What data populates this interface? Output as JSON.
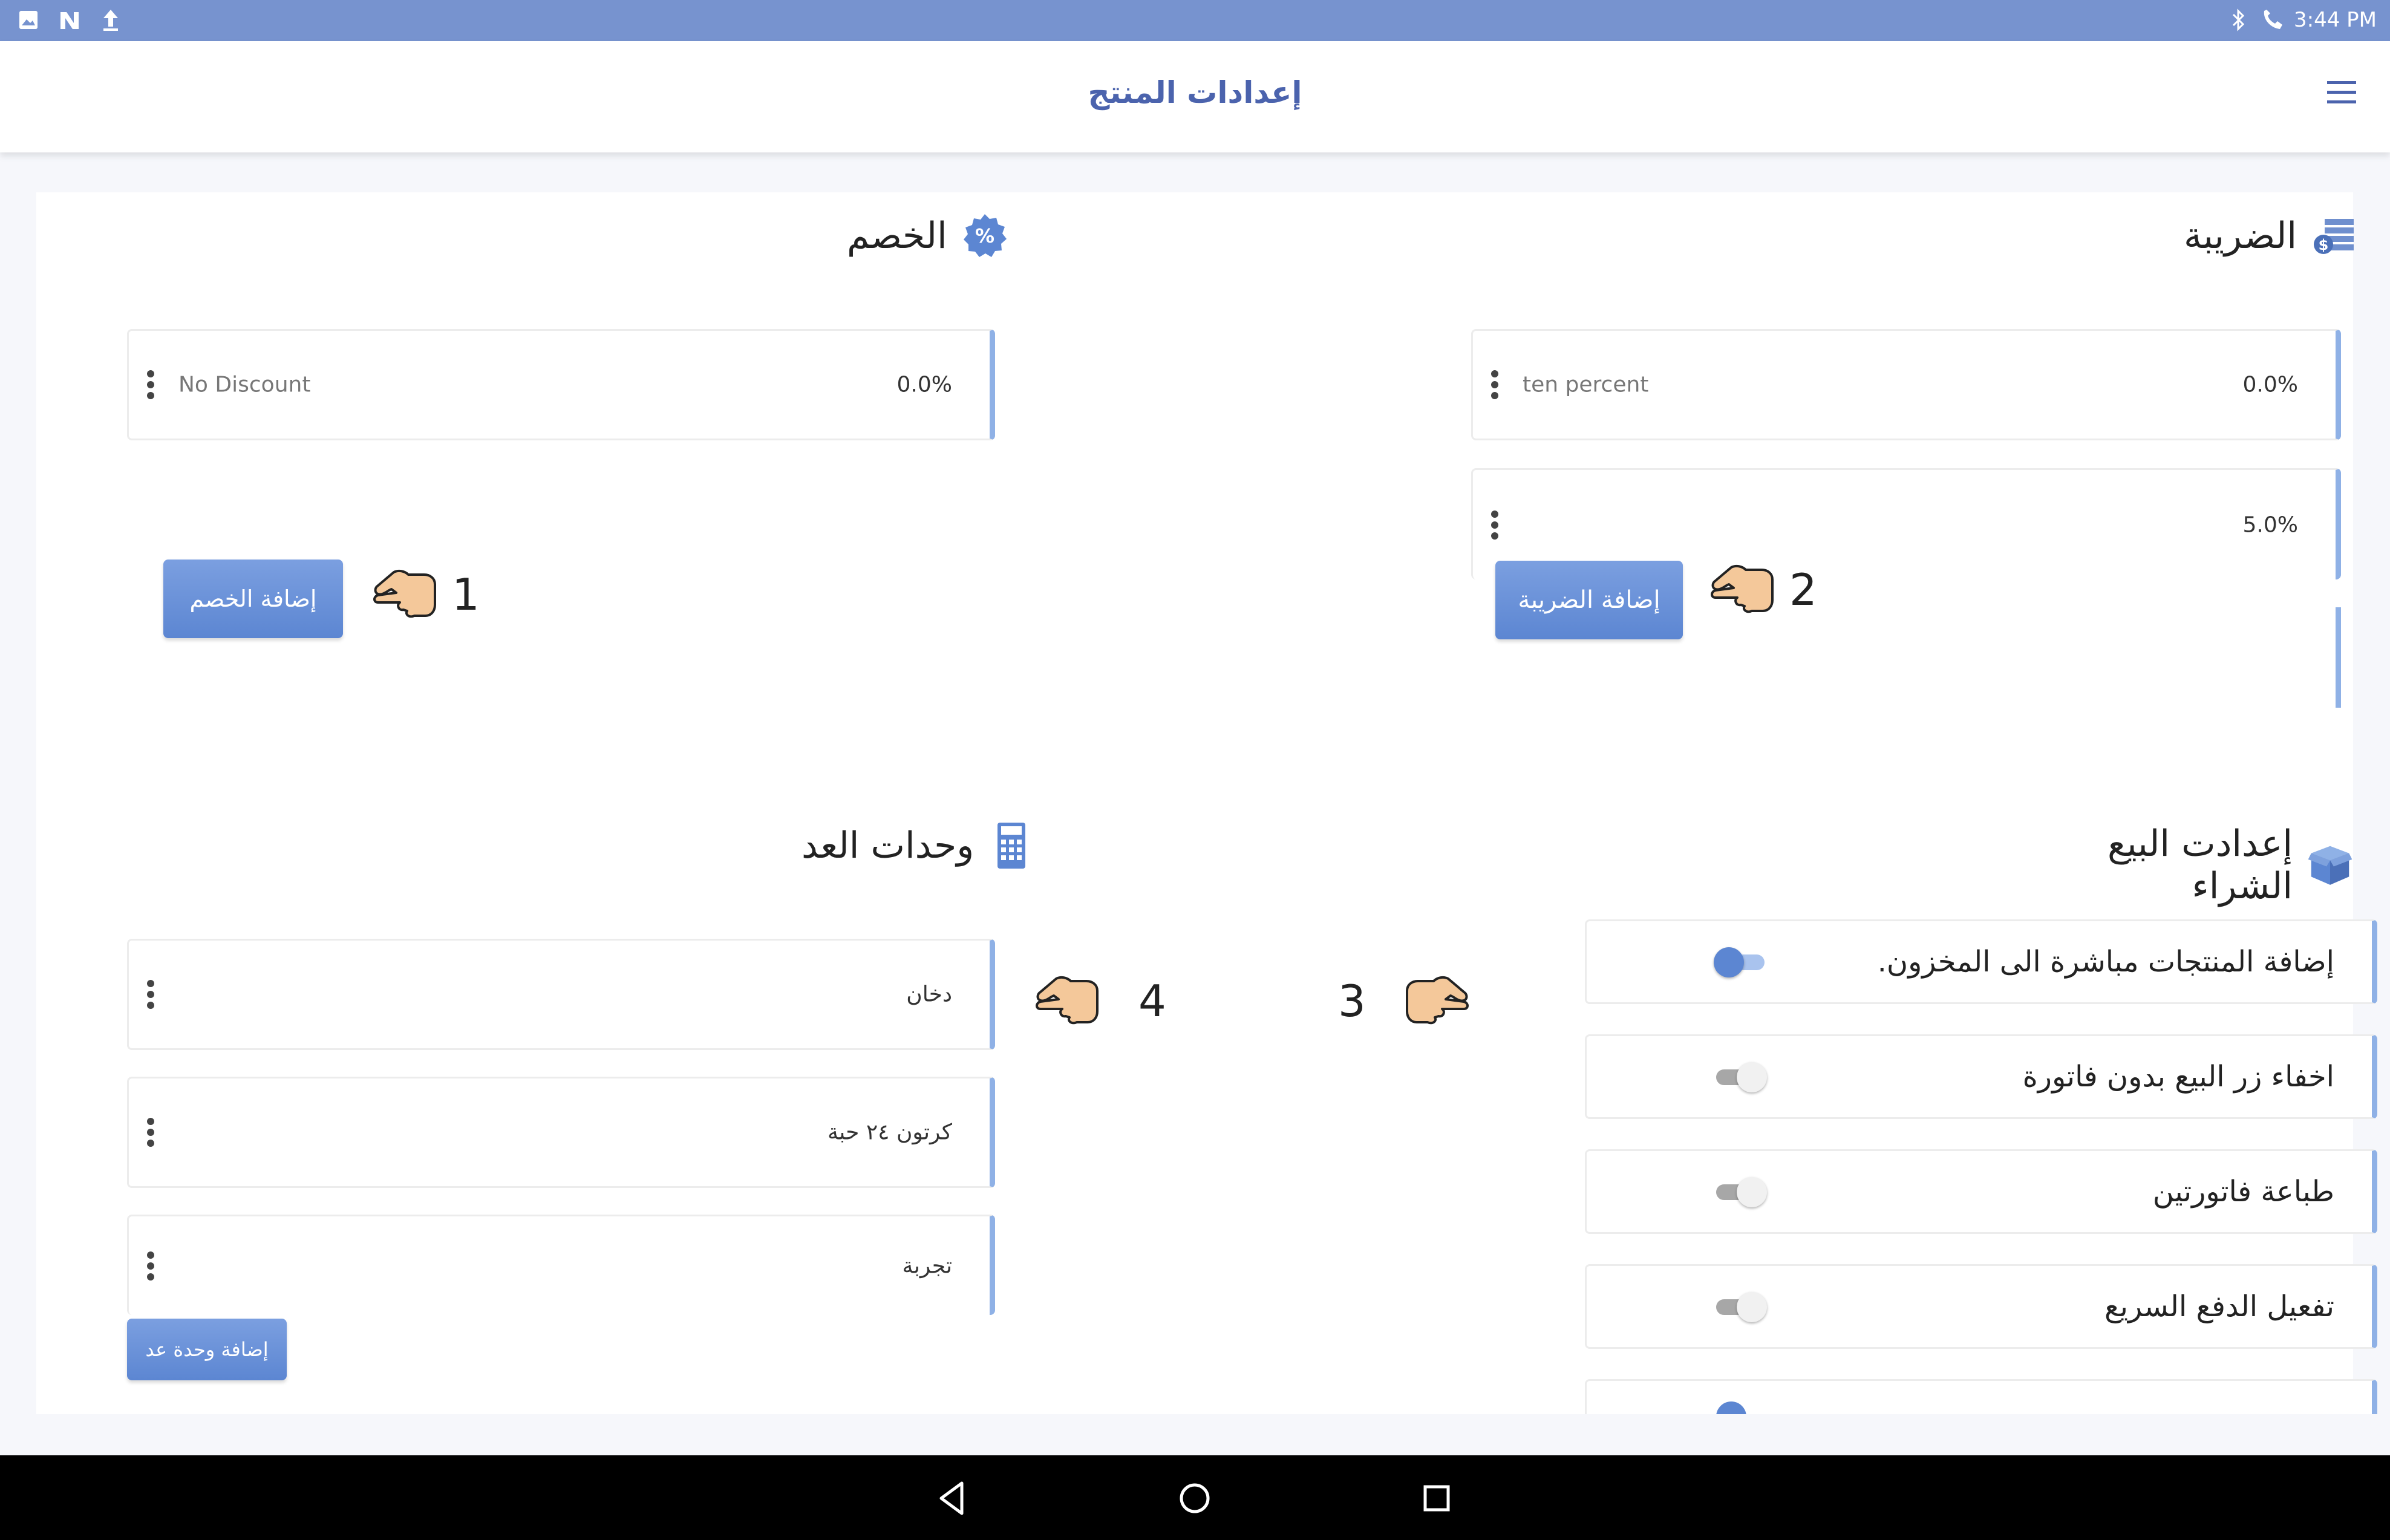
{
  "statusbar": {
    "time": "3:44 PM",
    "left_icons": [
      "image-icon",
      "n-icon",
      "upload-icon"
    ],
    "right_icons": [
      "bluetooth-icon",
      "phone-icon"
    ]
  },
  "appbar": {
    "title": "إعدادات المنتج",
    "menu_icon": "hamburger-menu-icon"
  },
  "discount": {
    "title": "الخصم",
    "icon": "percent-icon",
    "items": [
      {
        "name": "No Discount",
        "value": "0.0%"
      }
    ],
    "add_button": "إضافة الخصم",
    "hint_number": "1"
  },
  "tax": {
    "title": "الضريبة",
    "icon": "tax-money-icon",
    "items": [
      {
        "name": "ten percent",
        "value": "0.0%"
      },
      {
        "name": "",
        "value": "5.0%"
      }
    ],
    "add_button": "إضافة الضريبة",
    "hint_number": "2"
  },
  "units": {
    "title": "وحدات العد",
    "icon": "calculator-icon",
    "items": [
      {
        "name": "دخان"
      },
      {
        "name": "كرتون ٢٤ حبة"
      },
      {
        "name": "تجربة"
      }
    ],
    "add_button": "إضافة وحدة عد",
    "hint_number": "4"
  },
  "sales": {
    "title": "إعدادت البيع الشراء",
    "icon": "box-icon",
    "hint_number": "3",
    "toggles": [
      {
        "label": "إضافة المنتجات مباشرة الى المخزون.",
        "on": true
      },
      {
        "label": "اخفاء زر البيع بدون فاتورة",
        "on": false
      },
      {
        "label": "طباعة فاتورتين",
        "on": false
      },
      {
        "label": "تفعيل الدفع السريع",
        "on": false
      }
    ]
  },
  "colors": {
    "statusbar": "#7793cf",
    "accent": "#4b63ad",
    "card_border_accent": "#8fb1e6",
    "button": "#6a93da",
    "switch_on": "#5c86d2",
    "switch_off": "#d8d8d8"
  },
  "navbar": {
    "icons": [
      "back-icon",
      "home-icon",
      "recents-icon"
    ]
  }
}
